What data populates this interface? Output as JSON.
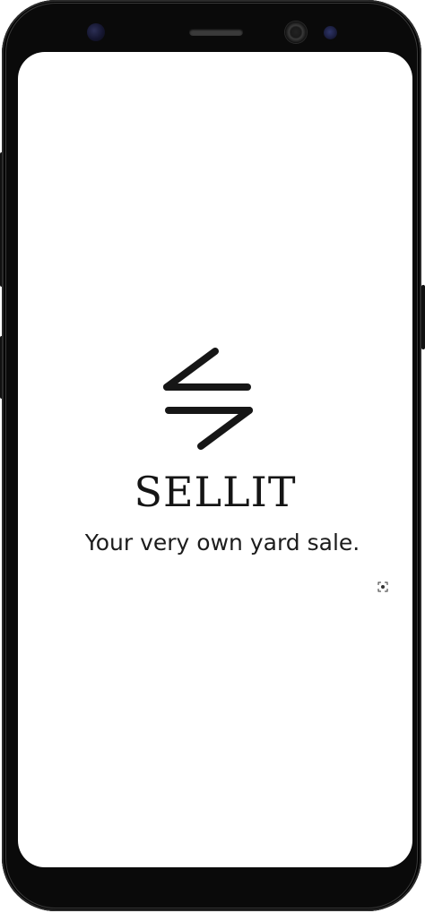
{
  "app": {
    "name": "SELLIT",
    "tagline": "Your very own yard sale."
  },
  "icons": {
    "logo": "double-slash-arrows-logo",
    "screenshot": "screenshot-capture-icon"
  },
  "colors": {
    "screen_background": "#ffffff",
    "text_primary": "#151515",
    "frame": "#0a0a0a"
  }
}
